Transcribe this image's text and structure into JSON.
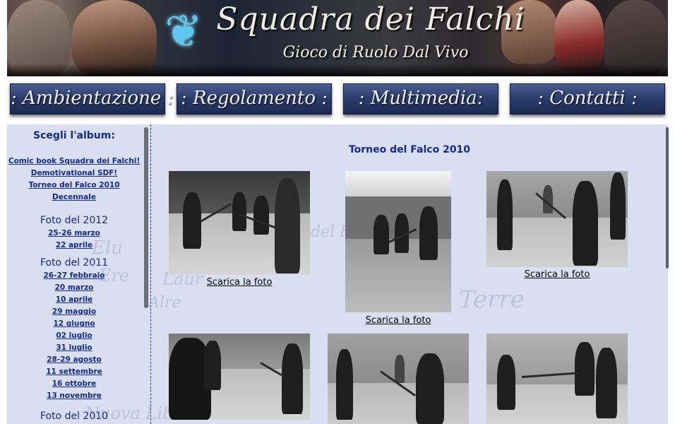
{
  "header": {
    "title": "Squadra dei Falchi",
    "subtitle": "Gioco di Ruolo Dal Vivo",
    "logo_icon": "eagle-icon"
  },
  "nav": [
    {
      "label": ": Ambientazione :"
    },
    {
      "label": ": Regolamento :"
    },
    {
      "label": ": Multimedia:"
    },
    {
      "label": ": Contatti :"
    }
  ],
  "sidebar": {
    "heading": "Scegli l'album:",
    "albums": [
      "Comic book Squadra dei Falchi!",
      "Demotivational SDF!",
      "Torneo del Falco 2010",
      "Decennale"
    ],
    "years": [
      {
        "year": "Foto del 2012",
        "items": [
          "25-26 marzo",
          "22 aprile"
        ]
      },
      {
        "year": "Foto del 2011",
        "items": [
          "26-27 febbraio",
          "20 marzo",
          "10 aprile",
          "29 maggio",
          "12 giugno",
          "02 luglio",
          "31 luglio",
          "28-29 agosto",
          "11 settembre",
          "16 ottobre",
          "13 novembre"
        ]
      },
      {
        "year": "Foto del 2010",
        "items": []
      }
    ]
  },
  "gallery": {
    "title": "Torneo del Falco 2010",
    "download_label": "Scarica la foto"
  },
  "colors": {
    "link": "#122b8c",
    "content_bg": "#d9dff0",
    "nav_button": "#2b3e6d"
  }
}
